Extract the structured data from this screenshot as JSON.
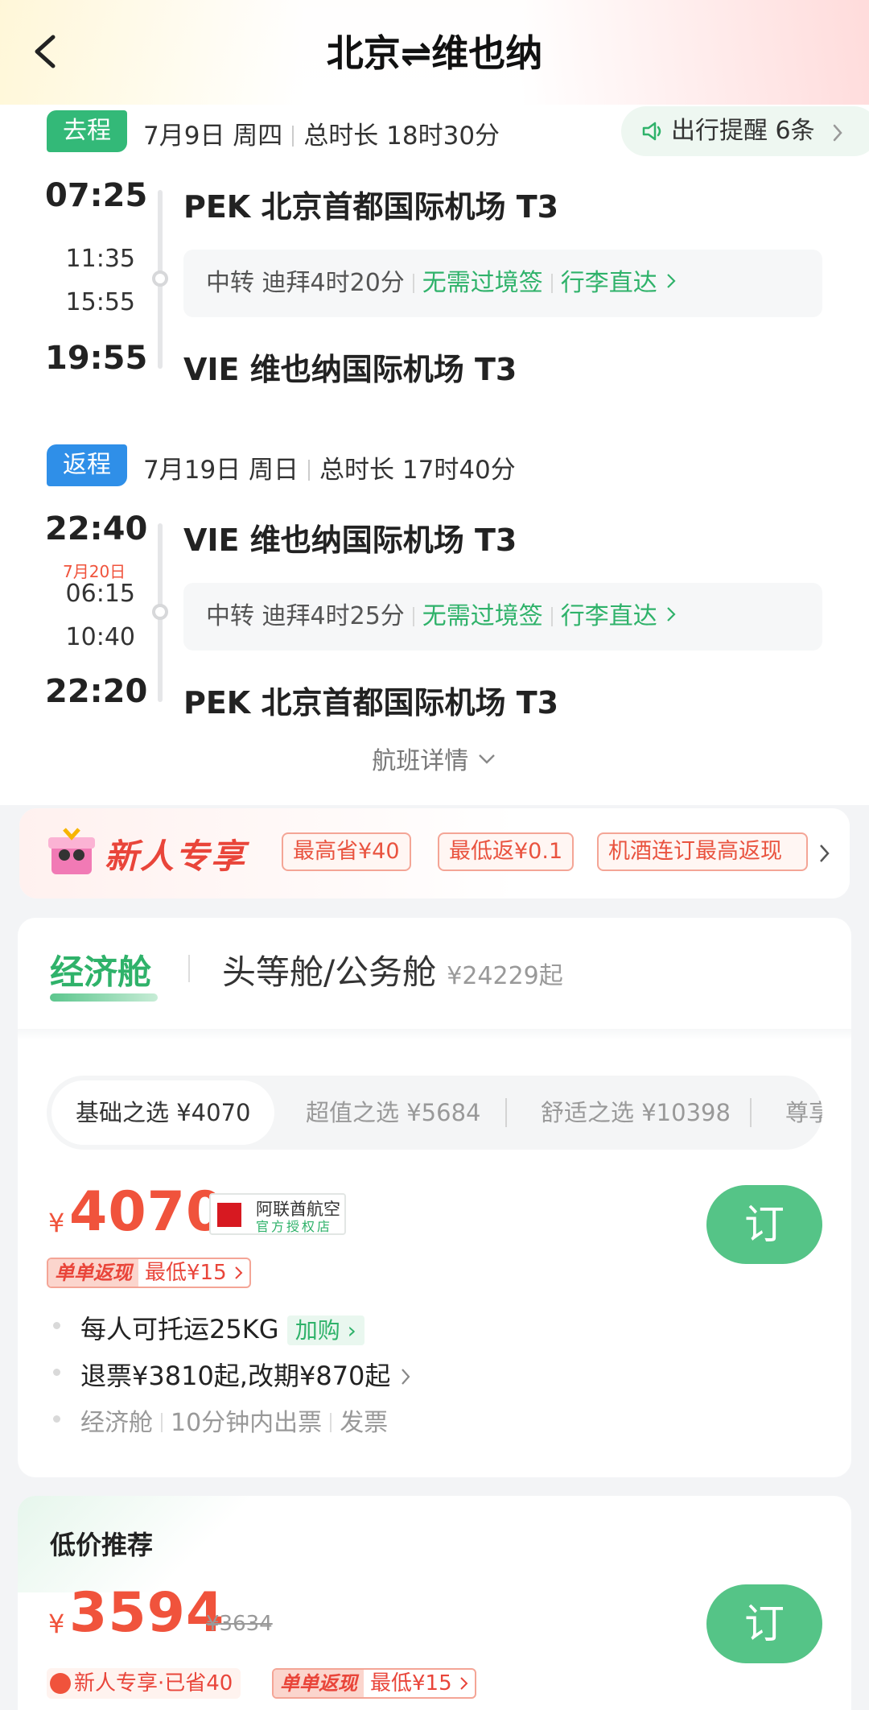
{
  "header": {
    "title": "北京⇌维也纳"
  },
  "outbound": {
    "tag": "去程",
    "date": "7月9日 周四",
    "duration": "总时长 18时30分",
    "dep_time": "07:25",
    "dep_airport": "PEK 北京首都国际机场 T3",
    "transfer_arr": "11:35",
    "transfer_dep": "15:55",
    "transfer_city": "中转 迪拜4时20分",
    "no_visa": "无需过境签",
    "baggage": "行李直达",
    "arr_time": "19:55",
    "arr_airport": "VIE 维也纳国际机场 T3"
  },
  "reminder": {
    "label": "出行提醒 6条"
  },
  "return": {
    "tag": "返程",
    "date": "7月19日 周日",
    "duration": "总时长 17时40分",
    "dep_time": "22:40",
    "dep_airport": "VIE 维也纳国际机场 T3",
    "next_day": "7月20日",
    "transfer_arr": "06:15",
    "transfer_dep": "10:40",
    "transfer_city": "中转 迪拜4时25分",
    "no_visa": "无需过境签",
    "baggage": "行李直达",
    "arr_time": "22:20",
    "arr_airport": "PEK 北京首都国际机场 T3"
  },
  "detail_link": "航班详情",
  "promo": {
    "title": "新人专享",
    "chips": [
      "最高省¥40",
      "最低返¥0.1",
      "机酒连订最高返现"
    ]
  },
  "cabins": {
    "economy": "经济舱",
    "business": "头等舱/公务舱",
    "business_price": "¥24229起"
  },
  "sub_tabs": [
    "基础之选 ¥4070",
    "超值之选 ¥5684",
    "舒适之选 ¥10398",
    "尊享"
  ],
  "fare": {
    "currency": "¥",
    "price": "4070",
    "airline_name": "阿联酋航空",
    "airline_sub": "官方授权店",
    "book": "订",
    "cashback_tag": "单单返现",
    "cashback_text": "最低¥15",
    "baggage": "每人可托运25KG",
    "add_on": "加购",
    "refund": "退票¥3810起,改期¥870起",
    "cabin": "经济舱",
    "ticketing": "10分钟内出票",
    "invoice": "发票"
  },
  "low_price": {
    "title": "低价推荐",
    "currency": "¥",
    "price": "3594",
    "old_price": "¥3634",
    "book": "订",
    "new_tag": "新人专享·已省40",
    "cashback_tag": "单单返现",
    "cashback_text": "最低¥15"
  },
  "colors": {
    "green": "#2fb26a",
    "orange": "#f0533c",
    "blue": "#2f8fe8"
  }
}
